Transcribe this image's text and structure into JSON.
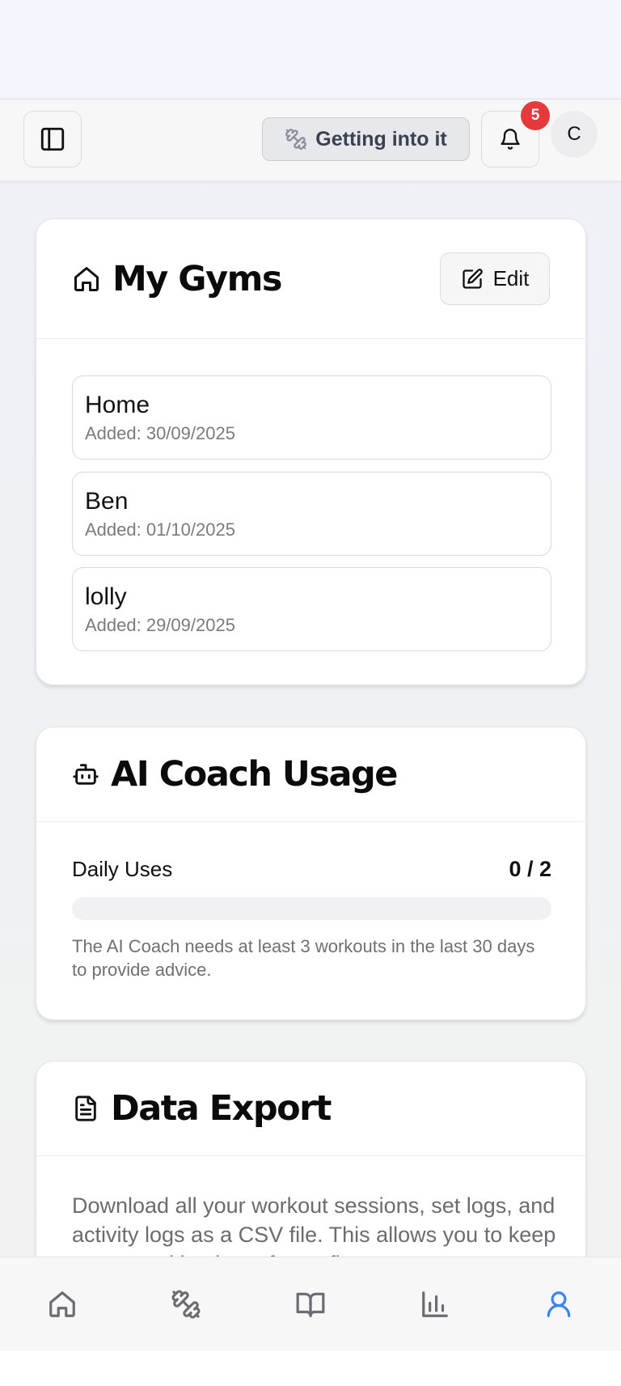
{
  "header": {
    "level_label": "Getting into it",
    "notification_count": "5",
    "avatar_initial": "C"
  },
  "gyms_card": {
    "title": "My Gyms",
    "edit_label": "Edit",
    "gyms": [
      {
        "name": "Home",
        "added": "Added: 30/09/2025"
      },
      {
        "name": "Ben",
        "added": "Added: 01/10/2025"
      },
      {
        "name": "lolly",
        "added": "Added: 29/09/2025"
      }
    ]
  },
  "coach_card": {
    "title": "AI Coach Usage",
    "usage_label": "Daily Uses",
    "usage_count": "0 / 2",
    "usage_fraction": 0,
    "note": "The AI Coach needs at least 3 workouts in the last 30 days to provide advice."
  },
  "export_card": {
    "title": "Data Export",
    "description": "Download all your workout sessions, set logs, and activity logs as a CSV file. This allows you to keep a personal backup of your fitness"
  },
  "bottom_nav": {
    "items": [
      {
        "icon": "home-icon",
        "active": false
      },
      {
        "icon": "dumbbell-icon",
        "active": false
      },
      {
        "icon": "book-icon",
        "active": false
      },
      {
        "icon": "bar-chart-icon",
        "active": false
      },
      {
        "icon": "user-icon",
        "active": true
      }
    ]
  },
  "colors": {
    "active_nav": "#3b82f6",
    "inactive_nav": "#6b6b72",
    "badge": "#e5393b"
  }
}
